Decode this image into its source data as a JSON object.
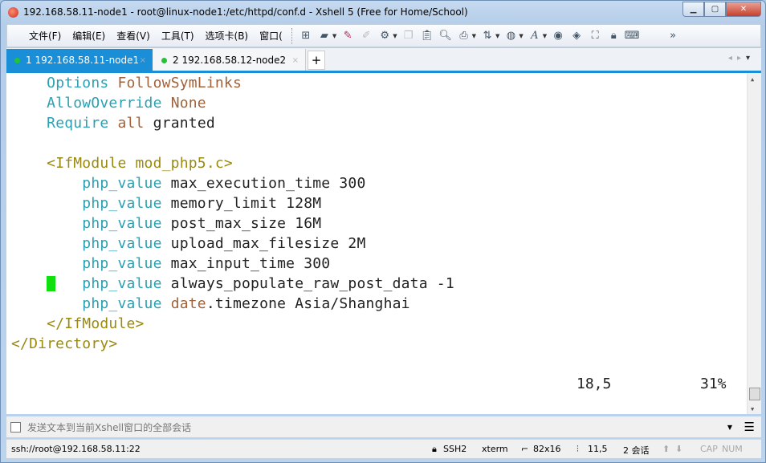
{
  "window": {
    "title": "192.168.58.11-node1 - root@linux-node1:/etc/httpd/conf.d - Xshell 5 (Free for Home/School)",
    "controls": [
      "minimize",
      "maximize",
      "close"
    ]
  },
  "menu": [
    "文件(F)",
    "编辑(E)",
    "查看(V)",
    "工具(T)",
    "选项卡(B)",
    "窗口("
  ],
  "toolbar_icons": [
    "new-session-icon",
    "open-folder-icon",
    "pen-icon",
    "eraser-icon",
    "properties-icon",
    "copy-icon",
    "paste-icon",
    "find-icon",
    "print-icon",
    "transfer-icon",
    "globe-icon",
    "font-icon",
    "xftp-icon",
    "xmanager-icon",
    "fullscreen-icon",
    "lock-icon",
    "keyboard-icon",
    "overflow-icon"
  ],
  "tabs": [
    {
      "label": "1 192.168.58.11-node1",
      "active": true,
      "status_color": "#22c23a"
    },
    {
      "label": "2 192.168.58.12-node2",
      "active": false,
      "status_color": "#22c23a"
    }
  ],
  "colors": {
    "keyword": "#2aa1b3",
    "value": "#a0623a",
    "tag": "#9a8a10",
    "text": "#222222",
    "cursor": "#10e010",
    "accent": "#1a8fd8"
  },
  "terminal": {
    "lines": [
      [
        [
          "    ",
          "text"
        ],
        [
          "Options",
          "keyword"
        ],
        [
          " ",
          "text"
        ],
        [
          "FollowSymLinks",
          "value"
        ]
      ],
      [
        [
          "    ",
          "text"
        ],
        [
          "AllowOverride",
          "keyword"
        ],
        [
          " ",
          "text"
        ],
        [
          "None",
          "value"
        ]
      ],
      [
        [
          "    ",
          "text"
        ],
        [
          "Require",
          "keyword"
        ],
        [
          " ",
          "text"
        ],
        [
          "all",
          "value"
        ],
        [
          " granted",
          "text"
        ]
      ],
      [],
      [
        [
          "    ",
          "text"
        ],
        [
          "<IfModule mod_php5.c>",
          "tag"
        ]
      ],
      [
        [
          "        ",
          "text"
        ],
        [
          "php_value",
          "keyword"
        ],
        [
          " max_execution_time 300",
          "text"
        ]
      ],
      [
        [
          "        ",
          "text"
        ],
        [
          "php_value",
          "keyword"
        ],
        [
          " memory_limit 128M",
          "text"
        ]
      ],
      [
        [
          "        ",
          "text"
        ],
        [
          "php_value",
          "keyword"
        ],
        [
          " post_max_size 16M",
          "text"
        ]
      ],
      [
        [
          "        ",
          "text"
        ],
        [
          "php_value",
          "keyword"
        ],
        [
          " upload_max_filesize 2M",
          "text"
        ]
      ],
      [
        [
          "        ",
          "text"
        ],
        [
          "php_value",
          "keyword"
        ],
        [
          " max_input_time 300",
          "text"
        ]
      ],
      [
        [
          "        ",
          "text"
        ],
        [
          "php_value",
          "keyword"
        ],
        [
          " always_populate_raw_post_data -1",
          "text"
        ]
      ],
      [
        [
          "        ",
          "text"
        ],
        [
          "php_value",
          "keyword"
        ],
        [
          " ",
          "text"
        ],
        [
          "date",
          "value"
        ],
        [
          ".timezone Asia/Shanghai",
          "text"
        ]
      ],
      [
        [
          "    ",
          "text"
        ],
        [
          "</IfModule>",
          "tag"
        ]
      ],
      [
        [
          "</Directory>",
          "tag"
        ]
      ]
    ],
    "cursor_position": "18,5",
    "scroll_percent": "31%"
  },
  "compose": {
    "placeholder": "发送文本到当前Xshell窗口的全部会话"
  },
  "status": {
    "connection": "ssh://root@192.168.58.11:22",
    "protocol": "SSH2",
    "term": "xterm",
    "size": "82x16",
    "position": "11,5",
    "sessions": "2 会话",
    "cap": "CAP",
    "num": "NUM"
  }
}
